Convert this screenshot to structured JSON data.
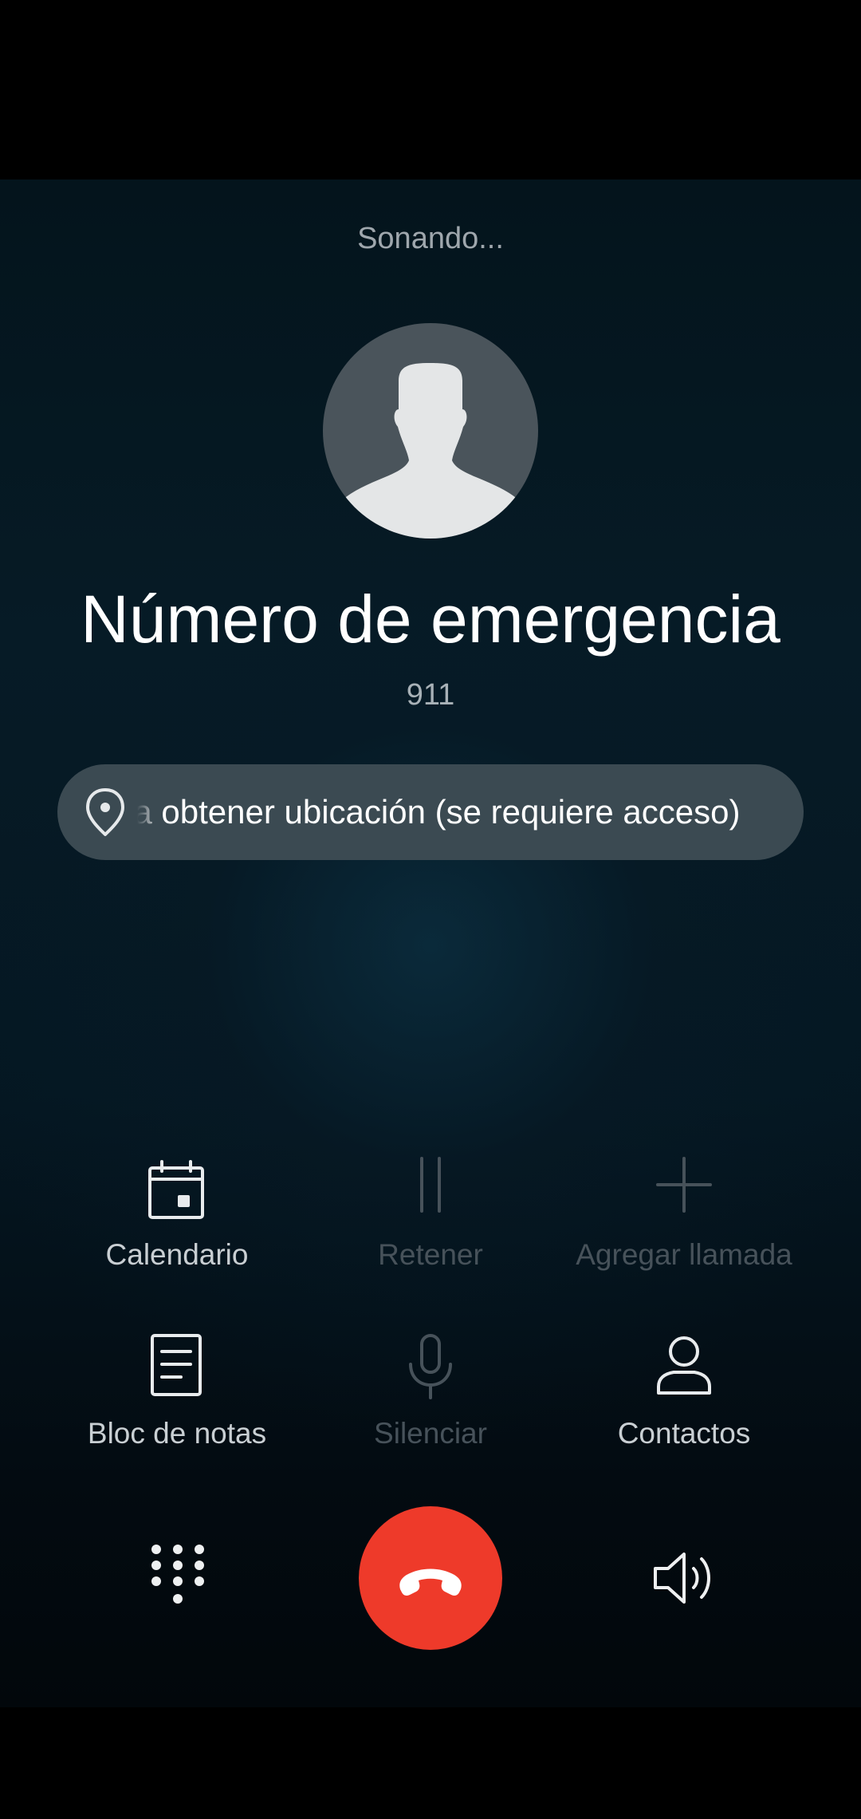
{
  "call": {
    "status": "Sonando...",
    "contact_name": "Número de emergencia",
    "number": "911",
    "location_text": "Para obtener ubicación (se requiere acceso)"
  },
  "actions": {
    "calendar": {
      "label": "Calendario",
      "icon": "calendar-icon",
      "enabled": true
    },
    "hold": {
      "label": "Retener",
      "icon": "pause-icon",
      "enabled": false
    },
    "add_call": {
      "label": "Agregar llamada",
      "icon": "plus-icon",
      "enabled": false
    },
    "notepad": {
      "label": "Bloc de notas",
      "icon": "notepad-icon",
      "enabled": true
    },
    "mute": {
      "label": "Silenciar",
      "icon": "microphone-icon",
      "enabled": false
    },
    "contacts": {
      "label": "Contactos",
      "icon": "person-icon",
      "enabled": true
    }
  },
  "bottom": {
    "dialpad_icon": "dialpad-icon",
    "end_call_icon": "hang-up-icon",
    "speaker_icon": "speaker-icon"
  },
  "colors": {
    "end_call": "#ee3a2a",
    "enabled_label": "#c9cfd3",
    "disabled_label": "#47525a",
    "pill_background": "#3b4a52"
  }
}
